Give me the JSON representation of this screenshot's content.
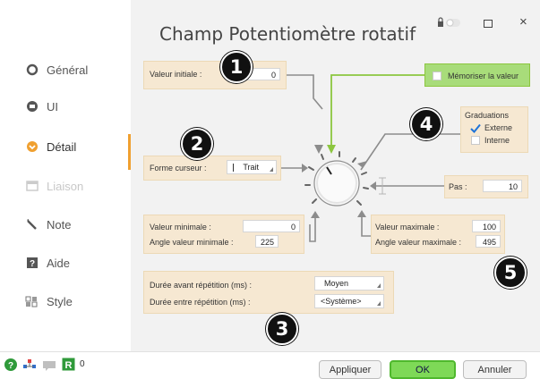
{
  "window": {
    "title": "Champ Potentiomètre rotatif",
    "controls": {
      "pin": "pin-icon",
      "maximize": "□",
      "close": "×"
    }
  },
  "sidebar": {
    "items": [
      {
        "label": "Général",
        "icon": "general-icon"
      },
      {
        "label": "UI",
        "icon": "ui-icon"
      },
      {
        "label": "Détail",
        "icon": "detail-icon",
        "active": true
      },
      {
        "label": "Liaison",
        "icon": "link-icon",
        "disabled": true
      },
      {
        "label": "Note",
        "icon": "note-icon"
      },
      {
        "label": "Aide",
        "icon": "help-icon"
      },
      {
        "label": "Style",
        "icon": "style-icon"
      }
    ],
    "accent": "#f0a030"
  },
  "detail": {
    "initial": {
      "label": "Valeur initiale :",
      "value": "0"
    },
    "memorize": {
      "label": "Mémoriser la valeur",
      "checked": false
    },
    "cursor": {
      "label": "Forme curseur :",
      "value": "Trait"
    },
    "graduations": {
      "title": "Graduations",
      "externe": {
        "label": "Externe",
        "checked": true
      },
      "interne": {
        "label": "Interne",
        "checked": false
      }
    },
    "step": {
      "label": "Pas :",
      "value": "10"
    },
    "min": {
      "value_label": "Valeur minimale :",
      "value": "0",
      "angle_label": "Angle valeur minimale :",
      "angle": "225"
    },
    "max": {
      "value_label": "Valeur maximale :",
      "value": "100",
      "angle_label": "Angle valeur maximale :",
      "angle": "495"
    },
    "repeat": {
      "before_label": "Durée avant répétition (ms) :",
      "before_value": "Moyen",
      "between_label": "Durée entre répétition (ms) :",
      "between_value": "<Système>"
    }
  },
  "badges": [
    "1",
    "2",
    "3",
    "4",
    "5"
  ],
  "footer": {
    "count": "0",
    "apply": "Appliquer",
    "ok": "OK",
    "cancel": "Annuler"
  },
  "colors": {
    "panel_bg": "#f6e8d2",
    "ok_green": "#7ed957",
    "memorize_green": "#a8dc7a",
    "connector_green": "#8cc63f"
  }
}
